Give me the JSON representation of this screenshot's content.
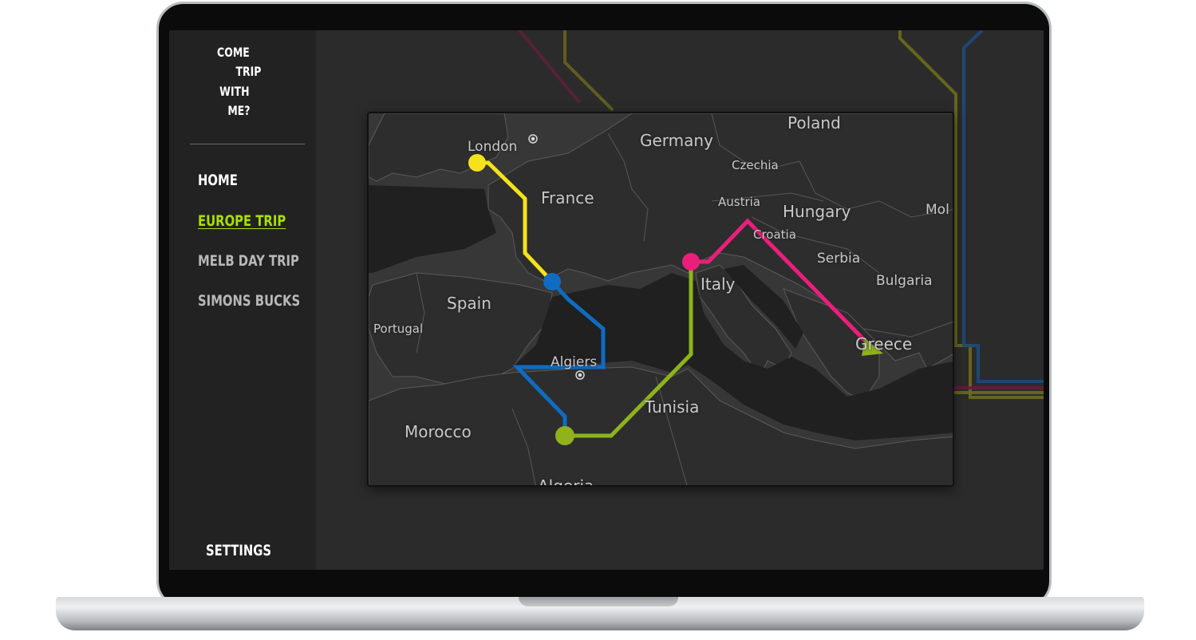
{
  "app": {
    "brand_lines": [
      "COME",
      "TRIP",
      "WITH",
      "ME?"
    ]
  },
  "sidebar": {
    "items": [
      {
        "label": "HOME",
        "active": false
      },
      {
        "label": "EUROPE TRIP",
        "active": true
      },
      {
        "label": "MELB DAY TRIP",
        "active": false
      },
      {
        "label": "SIMONS BUCKS",
        "active": false
      }
    ],
    "settings_label": "SETTINGS"
  },
  "map": {
    "labels": {
      "london": "London",
      "germany": "Germany",
      "poland": "Poland",
      "czechia": "Czechia",
      "france": "France",
      "austria": "Austria",
      "hungary": "Hungary",
      "moldova_partial": "Mol",
      "croatia": "Croatia",
      "serbia": "Serbia",
      "italy": "Italy",
      "bulgaria": "Bulgaria",
      "spain": "Spain",
      "portugal": "Portugal",
      "algiers": "Algiers",
      "greece": "Greece",
      "tunisia": "Tunisia",
      "morocco": "Morocco",
      "algeria": "Algeria"
    },
    "route_colors": {
      "yellow": "#f5e21b",
      "blue": "#0f6cc2",
      "green": "#8fb21d",
      "pink": "#ea1f7c"
    }
  },
  "colors": {
    "accent": "#a8e000",
    "screen_bg": "#2b2b2b",
    "sidebar_bg": "#222222"
  }
}
